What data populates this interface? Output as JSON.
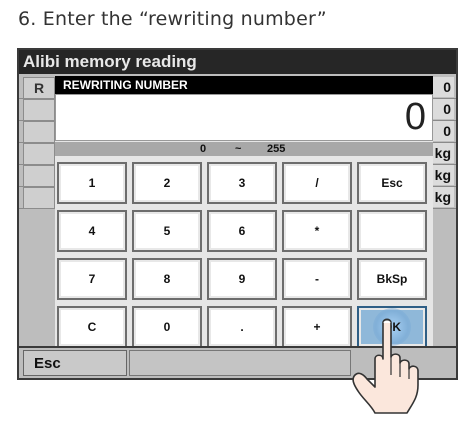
{
  "step": {
    "title": "6. Enter the “rewriting number”"
  },
  "screen": {
    "header": "Alibi memory reading"
  },
  "background": {
    "left_label": "R",
    "right_values": [
      "0",
      "0",
      "0",
      "kg",
      "kg",
      "kg"
    ]
  },
  "dialog": {
    "title": "REWRITING NUMBER",
    "value": "0",
    "range": {
      "min": "0",
      "sep": "~",
      "max": "255"
    }
  },
  "keypad": {
    "row1": [
      "1",
      "2",
      "3",
      "/",
      "Esc"
    ],
    "row2": [
      "4",
      "5",
      "6",
      "*",
      ""
    ],
    "row3": [
      "7",
      "8",
      "9",
      "-",
      "BkSp"
    ],
    "row4": [
      "C",
      "0",
      ".",
      "+",
      "OK"
    ]
  },
  "bottom": {
    "esc_label": "Esc"
  },
  "colors": {
    "ok_highlight": "#8fb8d9",
    "header_bg": "#262626",
    "screen_bg": "#bdbdbd"
  },
  "icons": {
    "pointer": "hand-pointer-icon"
  }
}
